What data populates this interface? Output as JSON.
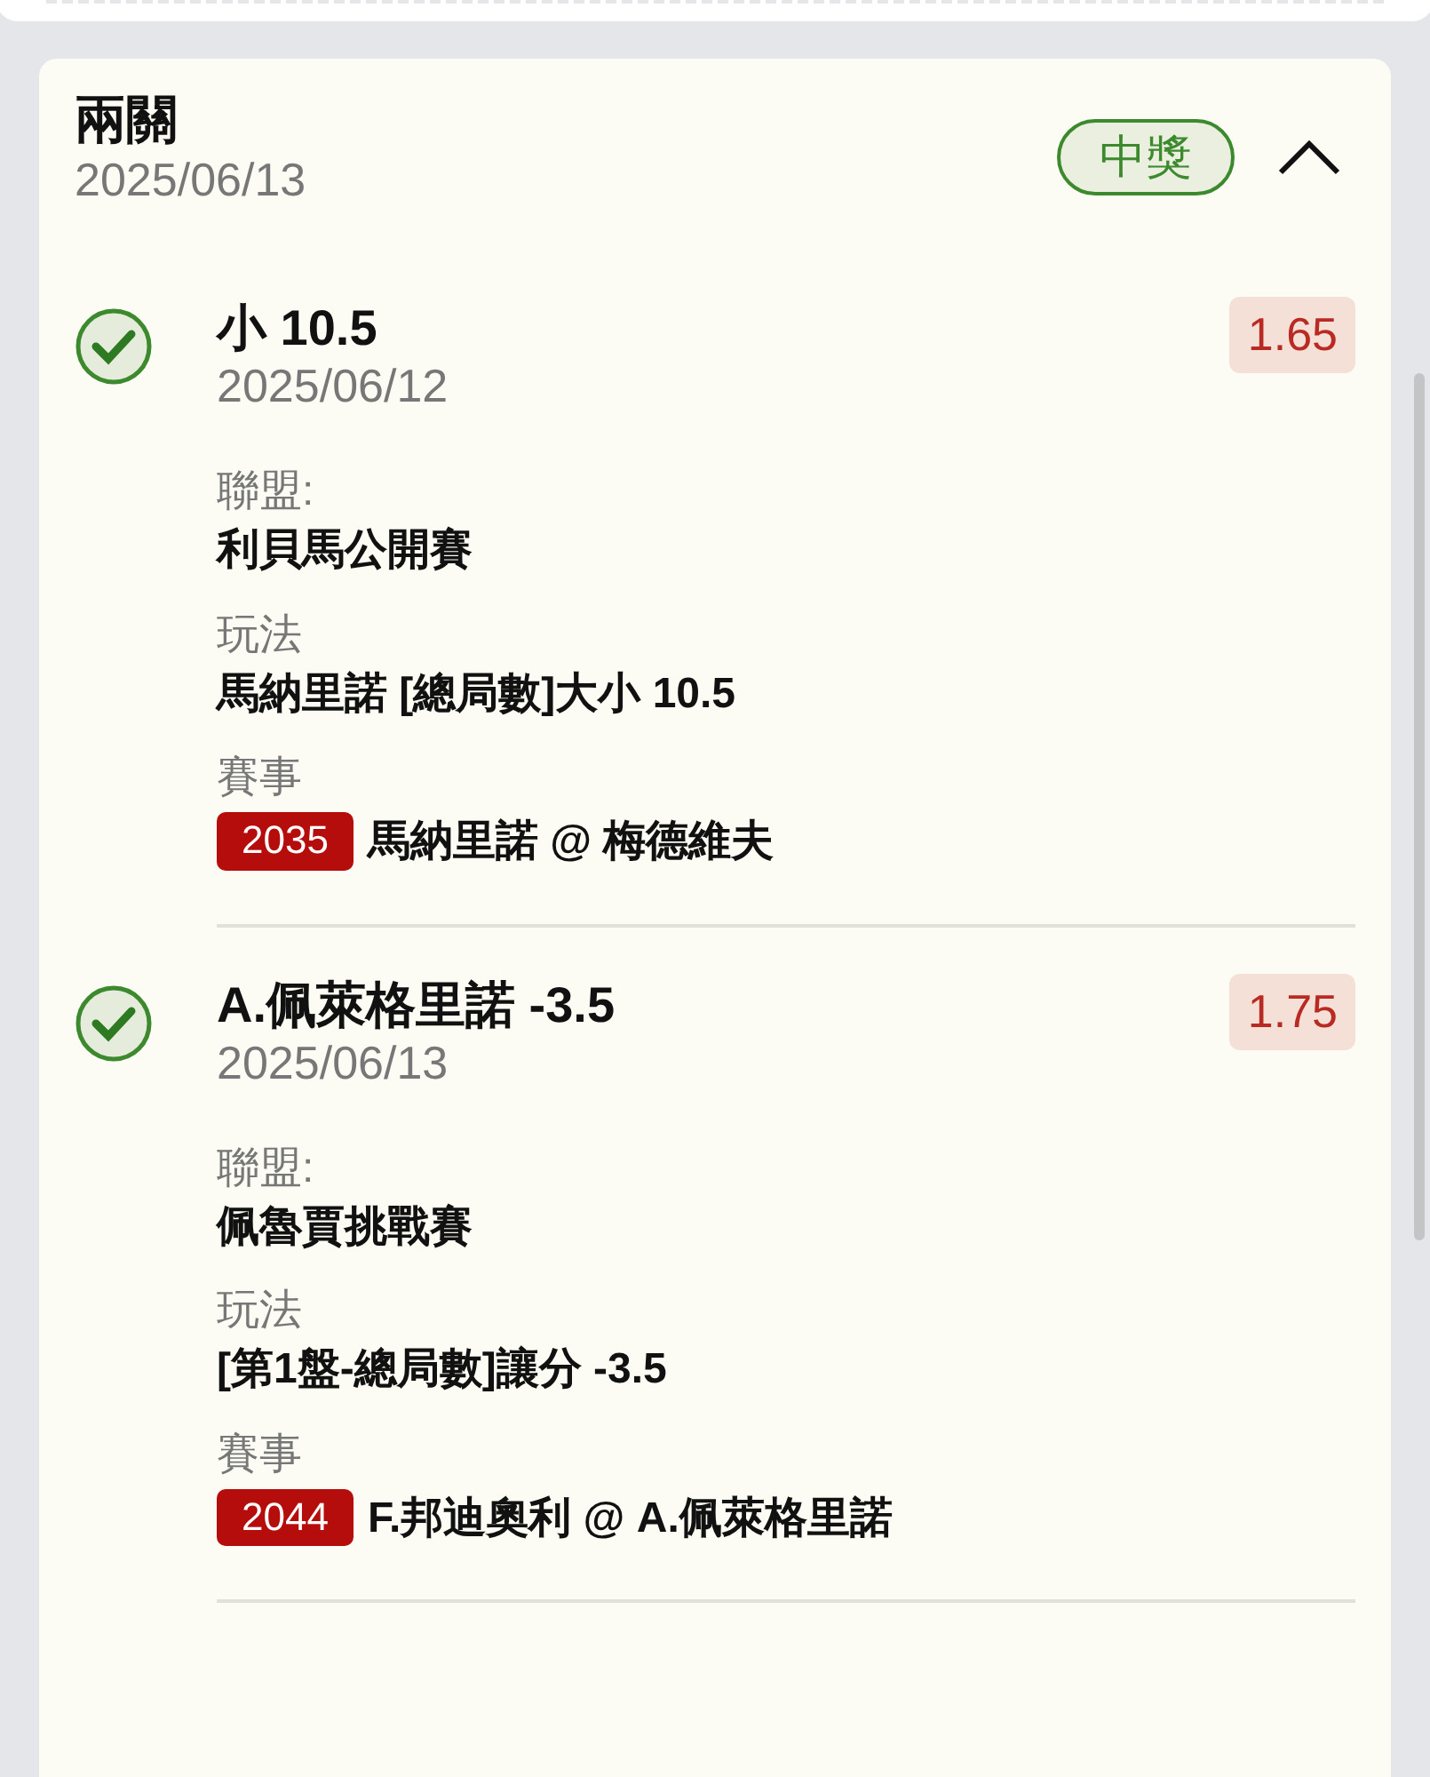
{
  "bet": {
    "title": "兩關",
    "date": "2025/06/13",
    "status": "中獎",
    "expanded": true
  },
  "legs": [
    {
      "won": true,
      "selection": "小 10.5",
      "date": "2025/06/12",
      "odds": "1.65",
      "league_label": "聯盟:",
      "league": "利貝馬公開賽",
      "market_label": "玩法",
      "market": "馬納里諾 [總局數]大小 10.5",
      "event_label": "賽事",
      "event_code": "2035",
      "event": "馬納里諾 @ 梅德維夫"
    },
    {
      "won": true,
      "selection": "A.佩萊格里諾 -3.5",
      "date": "2025/06/13",
      "odds": "1.75",
      "league_label": "聯盟:",
      "league": "佩魯賈挑戰賽",
      "market_label": "玩法",
      "market": "[第1盤-總局數]讓分 -3.5",
      "event_label": "賽事",
      "event_code": "2044",
      "event": "F.邦迪奧利 @ A.佩萊格里諾"
    }
  ]
}
